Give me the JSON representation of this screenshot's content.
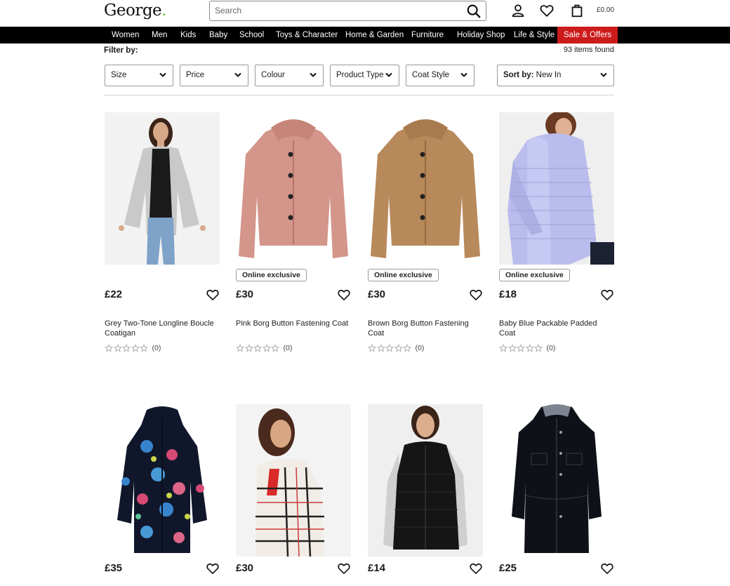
{
  "header": {
    "logo": "George",
    "logo_dot": ".",
    "search_placeholder": "Search",
    "basket_total": "£0.00"
  },
  "nav": {
    "items": [
      "Women",
      "Men",
      "Kids",
      "Baby",
      "School",
      "Toys & Character",
      "Home & Garden",
      "Furniture",
      "Holiday Shop",
      "Life & Style"
    ],
    "sale": "Sale & Offers"
  },
  "filters": {
    "label": "Filter by:",
    "items_found": "93 items found",
    "dropdowns": [
      "Size",
      "Price",
      "Colour",
      "Product Type",
      "Coat Style"
    ],
    "sort_label": "Sort by:",
    "sort_value": "New In"
  },
  "products": [
    {
      "price": "£22",
      "name": "Grey Two-Tone Longline Boucle Coatigan",
      "badge": "",
      "reviews": "(0)"
    },
    {
      "price": "£30",
      "name": "Pink Borg Button Fastening Coat",
      "badge": "Online exclusive",
      "reviews": "(0)"
    },
    {
      "price": "£30",
      "name": "Brown Borg Button Fastening Coat",
      "badge": "Online exclusive",
      "reviews": "(0)"
    },
    {
      "price": "£18",
      "name": "Baby Blue Packable Padded Coat",
      "badge": "Online exclusive",
      "reviews": "(0)"
    },
    {
      "price": "£35",
      "name": "",
      "badge": "",
      "reviews": ""
    },
    {
      "price": "£30",
      "name": "",
      "badge": "",
      "reviews": ""
    },
    {
      "price": "£14",
      "name": "",
      "badge": "",
      "reviews": ""
    },
    {
      "price": "£25",
      "name": "",
      "badge": "",
      "reviews": ""
    }
  ],
  "colors": {
    "nav_bg": "#000000",
    "sale_bg": "#cc1b1b",
    "logo_accent": "#7ac143"
  }
}
